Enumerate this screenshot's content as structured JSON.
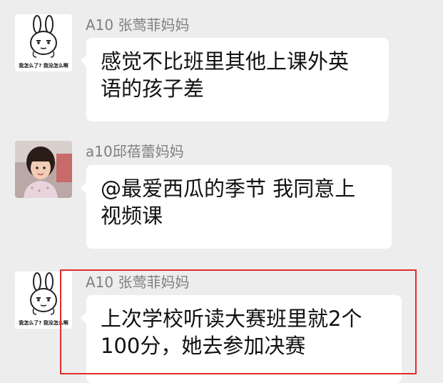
{
  "messages": [
    {
      "sender": "A10 张莺菲妈妈",
      "avatar": "rabbit-sticker-avatar",
      "avatar_caption": "我怎么了? 我没怎么啊",
      "lines": [
        "感觉不比班里其他上课外英",
        "语的孩子差"
      ]
    },
    {
      "sender": "a10邱蓓蕾妈妈",
      "avatar": "child-photo-avatar",
      "lines": [
        "@最爱西瓜的季节 我同意上",
        "视频课"
      ]
    },
    {
      "sender": "A10 张莺菲妈妈",
      "avatar": "rabbit-sticker-avatar",
      "avatar_caption": "我怎么了? 我没怎么啊",
      "lines": [
        "上次学校听读大赛班里就2个",
        "100分，她去参加决赛"
      ]
    }
  ],
  "colors": {
    "background": "#ededed",
    "bubble": "#ffffff",
    "sender_text": "#7f7f7f",
    "highlight_border": "#e02f2a"
  }
}
